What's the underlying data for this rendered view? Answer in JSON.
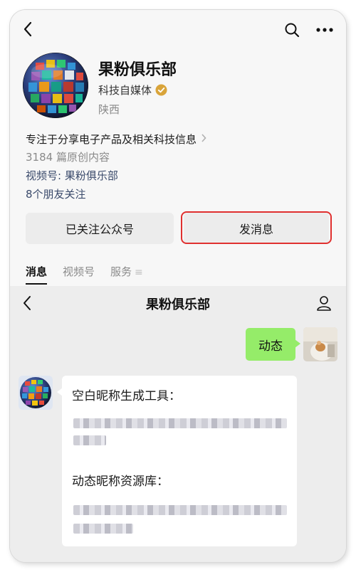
{
  "account": {
    "name": "果粉俱乐部",
    "category": "科技自媒体",
    "location": "陕西",
    "description": "专注于分享电子产品及相关科技信息",
    "original_posts": "3184 篇原创内容",
    "channel": "视频号: 果粉俱乐部",
    "friends_following": "8个朋友关注"
  },
  "actions": {
    "follow_label": "已关注公众号",
    "message_label": "发消息"
  },
  "tabs": [
    {
      "label": "消息",
      "active": true
    },
    {
      "label": "视频号",
      "active": false
    },
    {
      "label": "服务",
      "active": false
    }
  ],
  "chat": {
    "title": "果粉俱乐部",
    "sent_message": "动态",
    "received_line1": "空白昵称生成工具：",
    "received_line2": "动态昵称资源库："
  },
  "icons": {
    "back": "chevron-left-icon",
    "search": "search-icon",
    "more": "more-dots-icon",
    "verified": "verified-badge-icon",
    "profile": "person-icon"
  },
  "colors": {
    "accent_green": "#95ec69",
    "highlight_red": "#e0302f",
    "verified_gold": "#d9a43a",
    "link_blue": "#3a4a6b"
  }
}
